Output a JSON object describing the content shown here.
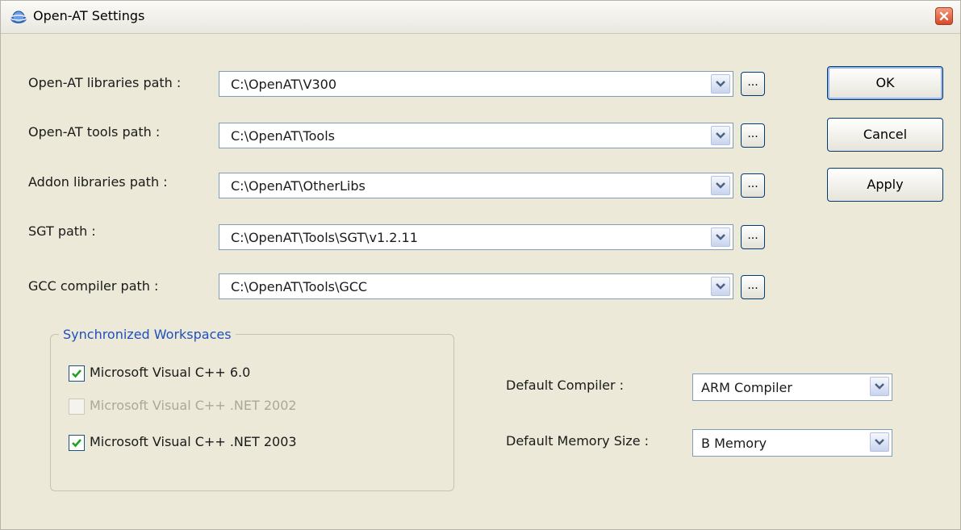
{
  "window": {
    "title": "Open-AT Settings"
  },
  "paths": [
    {
      "label": "Open-AT libraries path :",
      "value": "C:\\OpenAT\\V300",
      "browse": "..."
    },
    {
      "label": "Open-AT tools path :",
      "value": "C:\\OpenAT\\Tools",
      "browse": "..."
    },
    {
      "label": "Addon libraries path :",
      "value": "C:\\OpenAT\\OtherLibs",
      "browse": "..."
    },
    {
      "label": "SGT path :",
      "value": "C:\\OpenAT\\Tools\\SGT\\v1.2.11",
      "browse": "..."
    },
    {
      "label": "GCC compiler path :",
      "value": "C:\\OpenAT\\Tools\\GCC",
      "browse": "..."
    }
  ],
  "buttons": {
    "ok": "OK",
    "cancel": "Cancel",
    "apply": "Apply"
  },
  "workspaces": {
    "title": "Synchronized Workspaces",
    "items": [
      {
        "label": "Microsoft Visual C++ 6.0",
        "checked": true,
        "enabled": true
      },
      {
        "label": "Microsoft Visual C++ .NET 2002",
        "checked": false,
        "enabled": false
      },
      {
        "label": "Microsoft Visual C++ .NET 2003",
        "checked": true,
        "enabled": true
      }
    ]
  },
  "compiler": {
    "label": "Default Compiler :",
    "value": "ARM Compiler"
  },
  "memory": {
    "label": "Default Memory Size :",
    "value": "B Memory"
  },
  "icons": {
    "app": "open-at-app-icon",
    "close": "close-icon",
    "dropdown": "chevron-down-icon",
    "check": "checkmark-icon"
  },
  "colors": {
    "window_bg": "#ece9d8",
    "group_title": "#1f4fbf",
    "close_button": "#d6492a",
    "check_mark": "#21a121"
  }
}
